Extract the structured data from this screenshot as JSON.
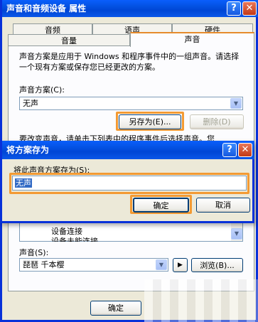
{
  "window": {
    "title": "声音和音频设备 属性",
    "help_glyph": "?",
    "close_glyph": "✕"
  },
  "tabs": {
    "row1": [
      "音频",
      "语声",
      "硬件"
    ],
    "row2": [
      "音量",
      "声音"
    ],
    "active": "声音"
  },
  "sounds_tab": {
    "description": "声音方案是应用于 Windows 和程序事件中的一组声音。请选择一个现有方案或保存您已经更改的方案。",
    "scheme_label": "声音方案(C):",
    "scheme_value": "无声",
    "save_as_button": "另存为(E)...",
    "delete_button": "删除(D)",
    "events_partial_text": "要改变声音，请单击下列表中的程序事件后选择声音。您",
    "events_list": [
      "设备连接",
      "设备未能连接"
    ],
    "sound_label": "声音(S):",
    "sound_value": "琵琶 千本樱",
    "play_glyph": "▶",
    "browse_button": "浏览(B)...",
    "ok_button": "确定"
  },
  "save_dialog": {
    "title": "将方案存为",
    "help_glyph": "?",
    "close_glyph": "✕",
    "prompt": "将此声音方案存为(S):",
    "input_value": "无声",
    "ok_button": "确定",
    "cancel_button": "取消"
  },
  "colors": {
    "titlebar": "#0350e0",
    "highlight": "#f39a33",
    "selection": "#316ac5"
  }
}
